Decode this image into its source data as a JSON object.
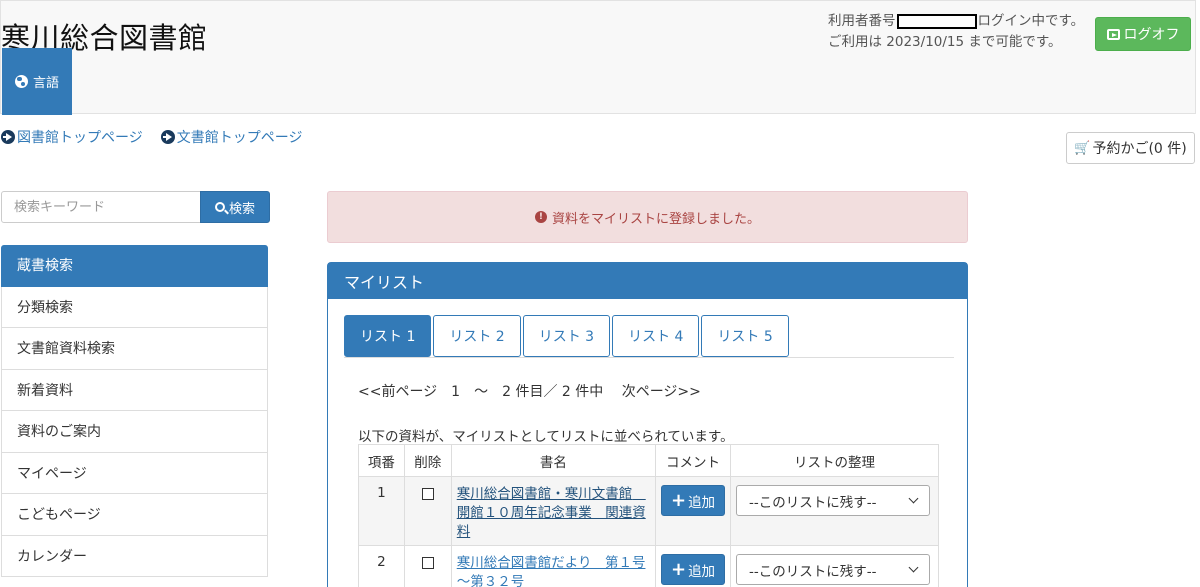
{
  "header": {
    "site_title": "寒川総合図書館",
    "language_label": "言語",
    "user_number_label": "利用者番号",
    "login_status": "ログイン中です。",
    "availability": "ご利用は 2023/10/15 まで可能です。",
    "logoff_label": "ログオフ"
  },
  "top_links": [
    {
      "label": "図書館トップページ"
    },
    {
      "label": "文書館トップページ"
    }
  ],
  "cart": {
    "label": "予約かご(0 件)"
  },
  "search": {
    "placeholder": "検索キーワード",
    "button_label": "検索"
  },
  "sidebar": {
    "items": [
      {
        "label": "蔵書検索"
      },
      {
        "label": "分類検索"
      },
      {
        "label": "文書館資料検索"
      },
      {
        "label": "新着資料"
      },
      {
        "label": "資料のご案内"
      },
      {
        "label": "マイページ"
      },
      {
        "label": "こどもページ"
      },
      {
        "label": "カレンダー"
      }
    ]
  },
  "alert": {
    "message": "資料をマイリストに登録しました。"
  },
  "mylist": {
    "title": "マイリスト",
    "tabs": [
      {
        "label": "リスト 1"
      },
      {
        "label": "リスト 2"
      },
      {
        "label": "リスト 3"
      },
      {
        "label": "リスト 4"
      },
      {
        "label": "リスト 5"
      }
    ],
    "pager": "<<前ページ　1　～　2 件目／ 2 件中　 次ページ>>",
    "intro": "以下の資料が、マイリストとしてリストに並べられています。",
    "columns": {
      "num": "項番",
      "delete": "削除",
      "title": "書名",
      "comment": "コメント",
      "organize": "リストの整理"
    },
    "rows": [
      {
        "num": "1",
        "title": "寒川総合図書館・寒川文書館　開館１０周年記念事業　関連資料",
        "add_label": "追加",
        "organize_value": "--このリストに残す--"
      },
      {
        "num": "2",
        "title": "寒川総合図書館だより　第１号～第３２号",
        "add_label": "追加",
        "organize_value": "--このリストに残す--"
      }
    ]
  },
  "colors": {
    "primary": "#337ab7",
    "success": "#5cb85c",
    "alert_bg": "#f2dede",
    "alert_text": "#a94442"
  }
}
